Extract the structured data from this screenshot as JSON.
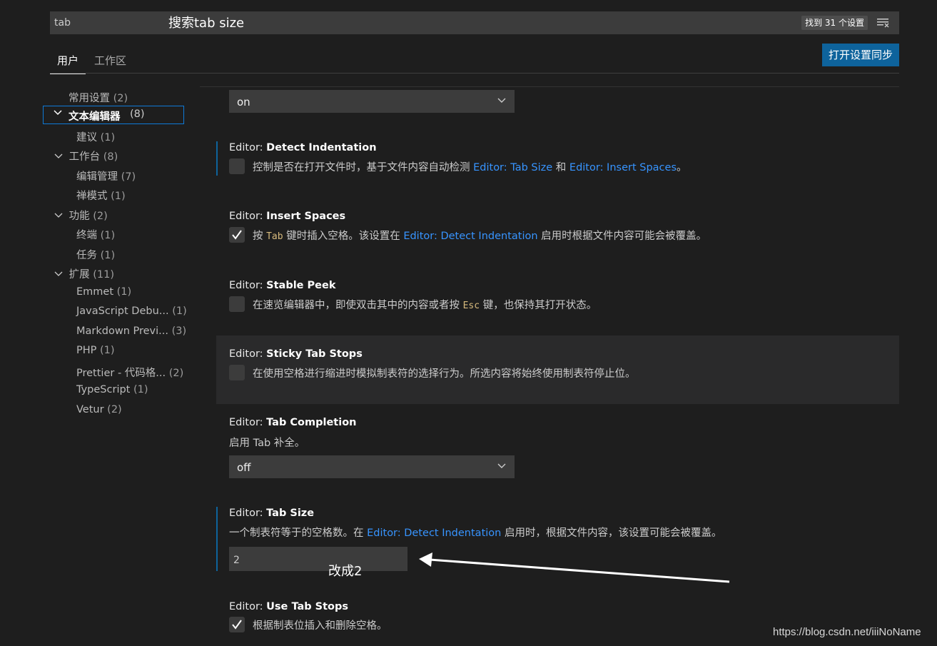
{
  "search": {
    "query": "tab",
    "found_label": "找到 31 个设置"
  },
  "annotations": {
    "search_hint": "搜索tab size",
    "change_hint": "改成2"
  },
  "tabs": [
    {
      "label": "用户"
    },
    {
      "label": "工作区"
    }
  ],
  "sync_button": "打开设置同步",
  "toc": [
    {
      "label": "常用设置",
      "count": "(2)"
    },
    {
      "label": "文本编辑器",
      "count": "(8)"
    },
    {
      "label": "建议",
      "count": "(1)"
    },
    {
      "label": "工作台",
      "count": "(8)"
    },
    {
      "label": "编辑管理",
      "count": "(7)"
    },
    {
      "label": "禅模式",
      "count": "(1)"
    },
    {
      "label": "功能",
      "count": "(2)"
    },
    {
      "label": "终端",
      "count": "(1)"
    },
    {
      "label": "任务",
      "count": "(1)"
    },
    {
      "label": "扩展",
      "count": "(11)"
    },
    {
      "label": "Emmet",
      "count": "(1)"
    },
    {
      "label": "JavaScript Debu...",
      "count": "(1)"
    },
    {
      "label": "Markdown Previ...",
      "count": "(3)"
    },
    {
      "label": "PHP",
      "count": "(1)"
    },
    {
      "label": "Prettier - 代码格...",
      "count": "(2)"
    },
    {
      "label": "TypeScript",
      "count": "(1)"
    },
    {
      "label": "Vetur",
      "count": "(2)"
    }
  ],
  "settings": {
    "top_dropdown": {
      "value": "on"
    },
    "detect_indentation": {
      "category": "Editor: ",
      "name": "Detect Indentation",
      "desc_a": "控制是否在打开文件时，基于文件内容自动检测 ",
      "link1": "Editor: Tab Size",
      "desc_b": " 和 ",
      "link2": "Editor: Insert Spaces",
      "desc_c": "。",
      "checked": false
    },
    "insert_spaces": {
      "category": "Editor: ",
      "name": "Insert Spaces",
      "desc_a": "按 ",
      "code": "Tab",
      "desc_b": " 键时插入空格。该设置在 ",
      "link1": "Editor: Detect Indentation",
      "desc_c": " 启用时根据文件内容可能会被覆盖。",
      "checked": true
    },
    "stable_peek": {
      "category": "Editor: ",
      "name": "Stable Peek",
      "desc_a": "在速览编辑器中，即使双击其中的内容或者按 ",
      "code": "Esc",
      "desc_b": " 键，也保持其打开状态。",
      "checked": false
    },
    "sticky_tab_stops": {
      "category": "Editor: ",
      "name": "Sticky Tab Stops",
      "desc": "在使用空格进行缩进时模拟制表符的选择行为。所选内容将始终使用制表符停止位。",
      "checked": false
    },
    "tab_completion": {
      "category": "Editor: ",
      "name": "Tab Completion",
      "desc": "启用 Tab 补全。",
      "value": "off"
    },
    "tab_size": {
      "category": "Editor: ",
      "name": "Tab Size",
      "desc_a": "一个制表符等于的空格数。在 ",
      "link1": "Editor: Detect Indentation",
      "desc_b": " 启用时，根据文件内容，该设置可能会被覆盖。",
      "value": "2"
    },
    "use_tab_stops": {
      "category": "Editor: ",
      "name": "Use Tab Stops",
      "desc": "根据制表位插入和删除空格。",
      "checked": true
    }
  },
  "watermark": "https://blog.csdn.net/iiiNoName",
  "colors": {
    "accent": "#0e639c",
    "link": "#3794ff",
    "background": "#1e1e1e"
  }
}
